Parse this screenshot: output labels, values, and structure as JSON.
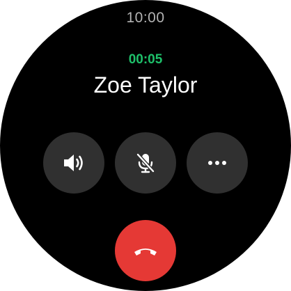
{
  "status_bar": {
    "time": "10:00"
  },
  "call": {
    "duration": "00:05",
    "caller_name": "Zoe Taylor"
  },
  "actions": [
    {
      "icon": "speaker-icon"
    },
    {
      "icon": "microphone-muted-icon"
    },
    {
      "icon": "more-options-icon"
    }
  ],
  "end_call": {
    "icon": "phone-hangup-icon"
  },
  "colors": {
    "background": "#000000",
    "timer": "#1ec06a",
    "button": "#303030",
    "end_call": "#e53935",
    "clock": "#b3b3b3"
  }
}
